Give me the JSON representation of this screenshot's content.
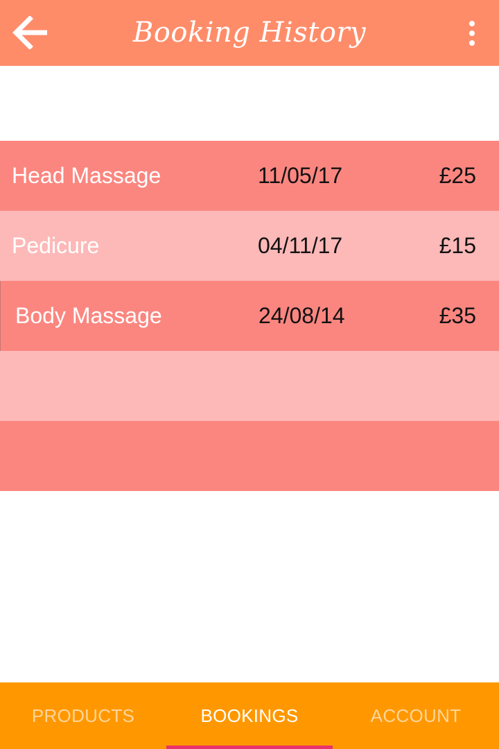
{
  "app_bar": {
    "title": "Booking History",
    "back_icon": "arrow-left-icon",
    "menu_icon": "more-vertical-icon",
    "background": "#ff8c69"
  },
  "bookings": [
    {
      "service": "Head Massage",
      "date": "11/05/17",
      "price": "£25"
    },
    {
      "service": "Pedicure",
      "date": "04/11/17",
      "price": "£15"
    },
    {
      "service": "Body Massage",
      "date": "24/08/14",
      "price": "£35"
    },
    {
      "service": "",
      "date": "",
      "price": ""
    },
    {
      "service": "",
      "date": "",
      "price": ""
    }
  ],
  "colors": {
    "row_dark": "#fb8680",
    "row_light": "#fdb9b8",
    "nav_background": "#ff9800",
    "nav_indicator": "#e8336b"
  },
  "bottom_nav": {
    "tabs": [
      {
        "label": "PRODUCTS",
        "active": false
      },
      {
        "label": "BOOKINGS",
        "active": true
      },
      {
        "label": "ACCOUNT",
        "active": false
      }
    ]
  }
}
